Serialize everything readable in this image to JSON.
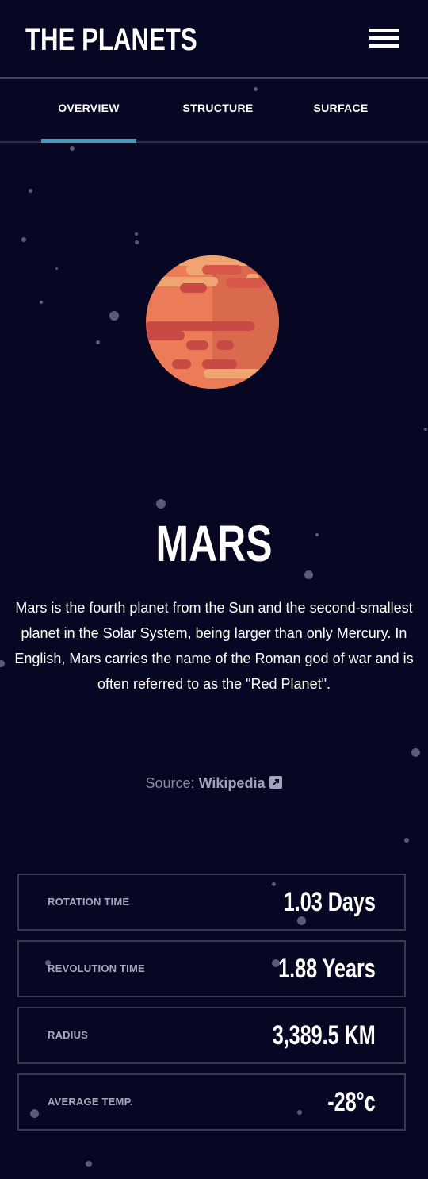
{
  "header": {
    "logo": "THE PLANETS",
    "menu_icon": "hamburger-menu-icon"
  },
  "tabs": [
    {
      "label": "OVERVIEW",
      "active": true
    },
    {
      "label": "STRUCTURE",
      "active": false
    },
    {
      "label": "SURFACE",
      "active": false
    }
  ],
  "colors": {
    "background": "#070724",
    "accent": "#419ebb",
    "planet_main": "#e0704e",
    "planet_light": "#f0a06e",
    "planet_dark": "#c2504a"
  },
  "planet": {
    "name": "MARS",
    "description": "Mars is the fourth planet from the Sun and the second-smallest planet in the Solar System, being larger than only Mercury. In English, Mars carries the name of the Roman god of war and is often referred to as the \"Red Planet\".",
    "source_label": "Source:",
    "source_link": "Wikipedia",
    "source_icon": "external-link-icon"
  },
  "stats": [
    {
      "label": "ROTATION TIME",
      "value": "1.03 Days"
    },
    {
      "label": "REVOLUTION TIME",
      "value": "1.88 Years"
    },
    {
      "label": "RADIUS",
      "value": "3,389.5 KM"
    },
    {
      "label": "AVERAGE TEMP.",
      "value": "-28°c"
    }
  ]
}
